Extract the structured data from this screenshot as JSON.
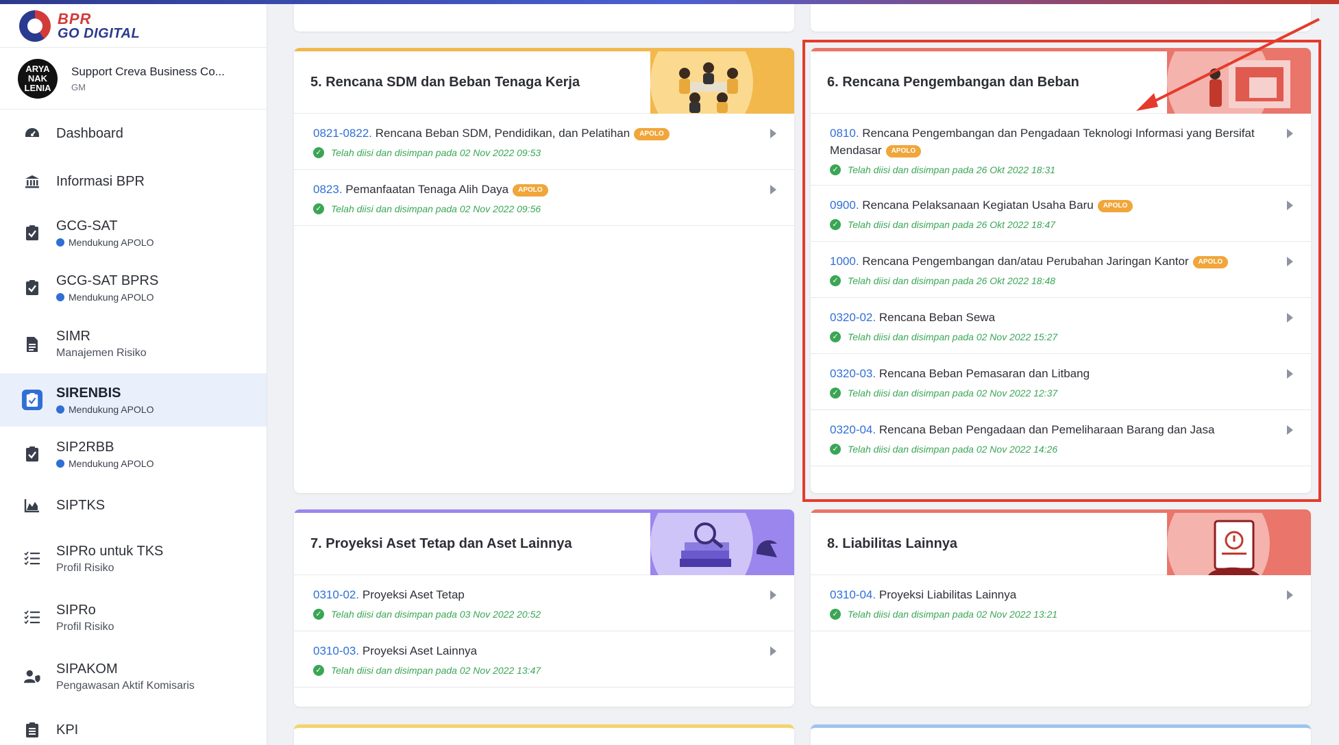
{
  "brand": {
    "line1": "BPR",
    "line2": "GO DIGITAL"
  },
  "user": {
    "avatar_text": "ARYA\nNAK\nLENIA",
    "name": "Support Creva Business Co...",
    "role": "GM"
  },
  "sidebar": {
    "items": [
      {
        "label": "Dashboard",
        "icon": "dashboard-gauge-icon"
      },
      {
        "label": "Informasi BPR",
        "icon": "bank-icon"
      },
      {
        "label": "GCG-SAT",
        "badge": "Mendukung APOLO",
        "icon": "clipboard-check-icon"
      },
      {
        "label": "GCG-SAT BPRS",
        "badge": "Mendukung APOLO",
        "icon": "clipboard-check-icon"
      },
      {
        "label": "SIMR",
        "sub": "Manajemen Risiko",
        "icon": "document-icon"
      },
      {
        "label": "SIRENBIS",
        "badge": "Mendukung APOLO",
        "icon": "clipboard-check-icon",
        "active": true
      },
      {
        "label": "SIP2RBB",
        "badge": "Mendukung APOLO",
        "icon": "clipboard-check-icon"
      },
      {
        "label": "SIPTKS",
        "icon": "area-chart-icon"
      },
      {
        "label": "SIPRo untuk TKS",
        "sub": "Profil Risiko",
        "icon": "checklist-icon"
      },
      {
        "label": "SIPRo",
        "sub": "Profil Risiko",
        "icon": "checklist-icon"
      },
      {
        "label": "SIPAKOM",
        "sub": "Pengawasan Aktif Komisaris",
        "icon": "user-shield-icon"
      },
      {
        "label": "KPI",
        "icon": "clipboard-list-icon"
      }
    ]
  },
  "cards": {
    "c5": {
      "title": "5. Rencana SDM dan Beban Tenaga Kerja",
      "accent": "#f2b84b",
      "rows": [
        {
          "code": "0821-0822.",
          "text": "Rencana Beban SDM, Pendidikan, dan Pelatihan",
          "apolo": "APOLO",
          "status": "Telah diisi dan disimpan pada 02 Nov 2022 09:53"
        },
        {
          "code": "0823.",
          "text": "Pemanfaatan Tenaga Alih Daya",
          "apolo": "APOLO",
          "status": "Telah diisi dan disimpan pada 02 Nov 2022 09:56"
        }
      ]
    },
    "c6": {
      "title": "6. Rencana Pengembangan dan Beban",
      "accent": "#e9756b",
      "rows": [
        {
          "code": "0810.",
          "text": "Rencana Pengembangan dan Pengadaan Teknologi Informasi yang Bersifat Mendasar",
          "apolo": "APOLO",
          "status": "Telah diisi dan disimpan pada 26 Okt 2022 18:31"
        },
        {
          "code": "0900.",
          "text": "Rencana Pelaksanaan Kegiatan Usaha Baru",
          "apolo": "APOLO",
          "status": "Telah diisi dan disimpan pada 26 Okt 2022 18:47"
        },
        {
          "code": "1000.",
          "text": "Rencana Pengembangan dan/atau Perubahan Jaringan Kantor",
          "apolo": "APOLO",
          "status": "Telah diisi dan disimpan pada 26 Okt 2022 18:48"
        },
        {
          "code": "0320-02.",
          "text": "Rencana Beban Sewa",
          "status": "Telah diisi dan disimpan pada 02 Nov 2022 15:27"
        },
        {
          "code": "0320-03.",
          "text": "Rencana Beban Pemasaran dan Litbang",
          "status": "Telah diisi dan disimpan pada 02 Nov 2022 12:37"
        },
        {
          "code": "0320-04.",
          "text": "Rencana Beban Pengadaan dan Pemeliharaan Barang dan Jasa",
          "status": "Telah diisi dan disimpan pada 02 Nov 2022 14:26"
        }
      ]
    },
    "c7": {
      "title": "7. Proyeksi Aset Tetap dan Aset Lainnya",
      "accent": "#9b86ee",
      "rows": [
        {
          "code": "0310-02.",
          "text": "Proyeksi Aset Tetap",
          "status": "Telah diisi dan disimpan pada 03 Nov 2022 20:52"
        },
        {
          "code": "0310-03.",
          "text": "Proyeksi Aset Lainnya",
          "status": "Telah diisi dan disimpan pada 02 Nov 2022 13:47"
        }
      ]
    },
    "c8": {
      "title": "8. Liabilitas Lainnya",
      "accent": "#e9756b",
      "rows": [
        {
          "code": "0310-04.",
          "text": "Proyeksi Liabilitas Lainnya",
          "status": "Telah diisi dan disimpan pada 02 Nov 2022 13:21"
        }
      ]
    }
  },
  "colors": {
    "primary": "#2f6fd6",
    "success": "#3aa655",
    "apolo": "#f0a63a",
    "highlight": "#e53b2c"
  }
}
